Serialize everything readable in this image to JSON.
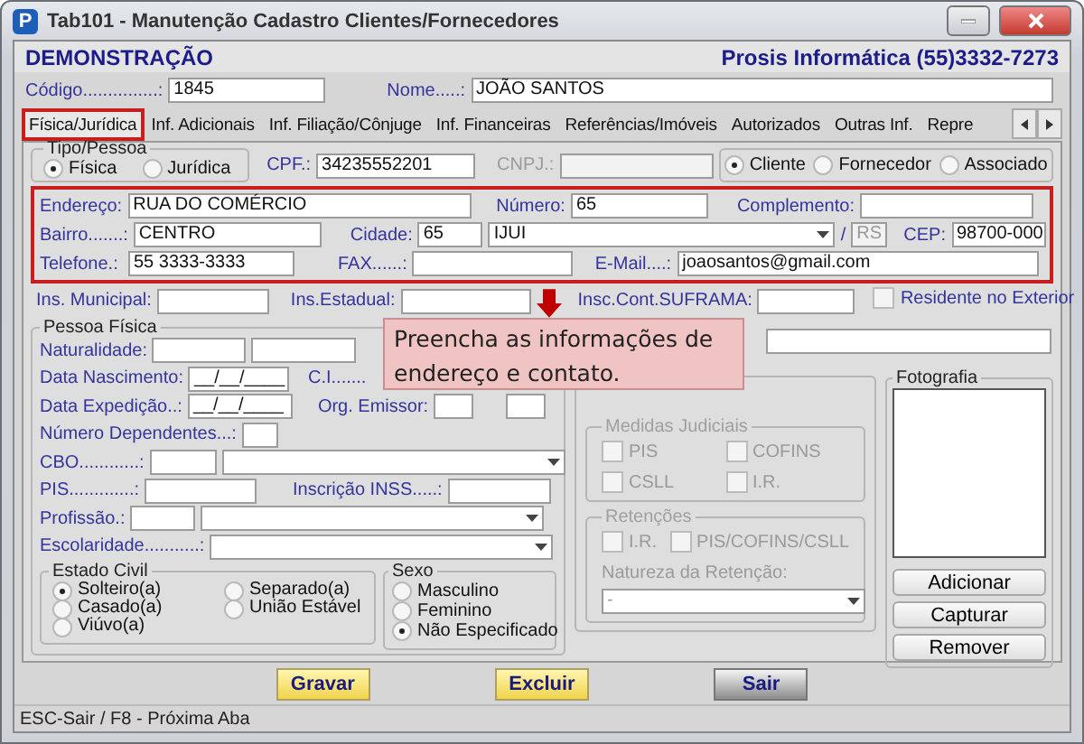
{
  "window": {
    "title": "Tab101 - Manutenção Cadastro Clientes/Fornecedores",
    "icon_letter": "P"
  },
  "header": {
    "company": "DEMONSTRAÇÃO",
    "contact": "Prosis Informática (55)3332-7273"
  },
  "record": {
    "code": {
      "label": "Código...............:",
      "value": "1845"
    },
    "name": {
      "label": "Nome.....:",
      "value": "JOÃO SANTOS"
    }
  },
  "tabs": [
    {
      "label": "Física/Jurídica",
      "selected": true
    },
    {
      "label": "Inf. Adicionais",
      "selected": false
    },
    {
      "label": "Inf. Filiação/Cônjuge",
      "selected": false
    },
    {
      "label": "Inf. Financeiras",
      "selected": false
    },
    {
      "label": "Referências/Imóveis",
      "selected": false
    },
    {
      "label": "Autorizados",
      "selected": false
    },
    {
      "label": "Outras Inf.",
      "selected": false
    },
    {
      "label": "Repre",
      "selected": false
    }
  ],
  "person_type": {
    "title": "Tipo/Pessoa",
    "options": [
      {
        "label": "Física",
        "selected": true
      },
      {
        "label": "Jurídica",
        "selected": false
      }
    ]
  },
  "cpf": {
    "label": "CPF.:",
    "value": "34235552201"
  },
  "cnpj": {
    "label": "CNPJ.:",
    "disabled": true
  },
  "role": {
    "options": [
      {
        "label": "Cliente",
        "selected": true
      },
      {
        "label": "Fornecedor",
        "selected": false
      },
      {
        "label": "Associado",
        "selected": false
      }
    ]
  },
  "address": {
    "highlighted": true,
    "street": {
      "label": "Endereço:",
      "value": "RUA DO COMÉRCIO"
    },
    "number": {
      "label": "Número:",
      "value": "65"
    },
    "complement": {
      "label": "Complemento:"
    },
    "district": {
      "label": "Bairro.......:",
      "value": "CENTRO"
    },
    "city": {
      "label": "Cidade:",
      "code": "65",
      "name": "IJUI",
      "separator": "/",
      "state": "RS",
      "state_disabled": true
    },
    "zip": {
      "label": "CEP:",
      "value": "98700-000"
    },
    "phone": {
      "label": "Telefone.:",
      "value": "55 3333-3333"
    },
    "fax": {
      "label": "FAX......:"
    },
    "email": {
      "label": "E-Mail....:",
      "value": "joaosantos@gmail.com"
    }
  },
  "registrations": {
    "municipal": {
      "label": "Ins. Municipal:"
    },
    "state": {
      "label": "Ins.Estadual:"
    },
    "suframa": {
      "label": "Insc.Cont.SUFRAMA:"
    },
    "resident_abroad": {
      "label": "Residente no Exterior",
      "checked": false
    }
  },
  "natural_person": {
    "title": "Pessoa Física",
    "birthplace": {
      "label": "Naturalidade:"
    },
    "birth_date": {
      "label": "Data Nascimento:",
      "value": "__/__/____"
    },
    "id_card": {
      "label": "C.I......."
    },
    "issue_date": {
      "label": "Data Expedição..:",
      "value": "__/__/____"
    },
    "issuer": {
      "label": "Org. Emissor:"
    },
    "dependents": {
      "label": "Número Dependentes...:"
    },
    "cbo": {
      "label": "CBO............:"
    },
    "pis": {
      "label": "PIS.............:"
    },
    "inss": {
      "label": "Inscrição INSS.....:"
    },
    "profession": {
      "label": "Profissão.:"
    },
    "education": {
      "label": "Escolaridade...........:"
    },
    "marital_status": {
      "title": "Estado Civil",
      "options": [
        {
          "label": "Solteiro(a)",
          "selected": true
        },
        {
          "label": "Casado(a)",
          "selected": false
        },
        {
          "label": "Viúvo(a)",
          "selected": false
        },
        {
          "label": "Separado(a)",
          "selected": false
        },
        {
          "label": "União Estável",
          "selected": false
        }
      ]
    },
    "sex": {
      "title": "Sexo",
      "options": [
        {
          "label": "Masculino",
          "selected": false
        },
        {
          "label": "Feminino",
          "selected": false
        },
        {
          "label": "Não Especificado",
          "selected": true
        }
      ]
    }
  },
  "legal": {
    "disabled": true,
    "judicial": {
      "title": "Medidas Judiciais",
      "options": [
        {
          "label": "PIS",
          "checked": false
        },
        {
          "label": "COFINS",
          "checked": false
        },
        {
          "label": "CSLL",
          "checked": false
        },
        {
          "label": "I.R.",
          "checked": false
        }
      ]
    },
    "withholding": {
      "title": "Retenções",
      "options": [
        {
          "label": "I.R.",
          "checked": false
        },
        {
          "label": "PIS/COFINS/CSLL",
          "checked": false
        }
      ],
      "nature_label": "Natureza da Retenção:",
      "nature": "-"
    }
  },
  "photo": {
    "title": "Fotografia",
    "buttons": [
      "Adicionar",
      "Capturar",
      "Remover"
    ]
  },
  "callout": {
    "text": "Preencha as informações de endereço e contato."
  },
  "buttons": [
    {
      "label": "Gravar",
      "kind": "primary"
    },
    {
      "label": "Excluir",
      "kind": "primary"
    },
    {
      "label": "Sair",
      "kind": "neutral"
    }
  ],
  "status_bar": "ESC-Sair / F8 - Próxima Aba"
}
